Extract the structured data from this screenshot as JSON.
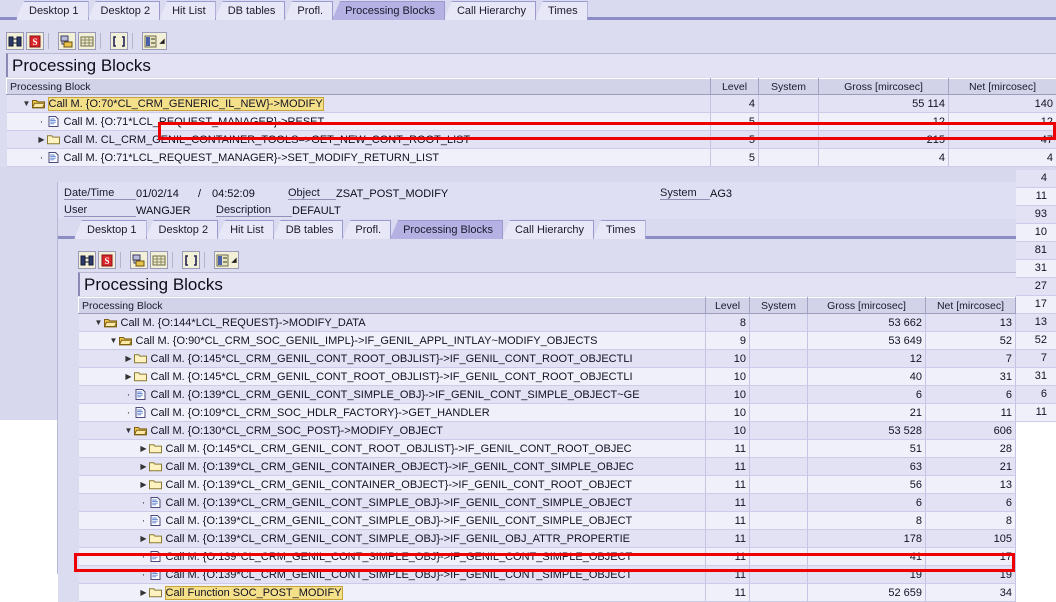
{
  "window1": {
    "tabs": [
      {
        "label": "Desktop 1",
        "active": false
      },
      {
        "label": "Desktop 2",
        "active": false
      },
      {
        "label": "Hit List",
        "active": false
      },
      {
        "label": "DB tables",
        "active": false
      },
      {
        "label": "Profl.",
        "active": false
      },
      {
        "label": "Processing Blocks",
        "active": true
      },
      {
        "label": "Call Hierarchy",
        "active": false
      },
      {
        "label": "Times",
        "active": false
      }
    ],
    "toolbar": [
      {
        "name": "find-icon",
        "glyph": "binoculars"
      },
      {
        "name": "find-next-icon",
        "glyph": "s-red"
      },
      {
        "name": "expand-tree-icon",
        "glyph": "tree"
      },
      {
        "name": "grid-icon",
        "glyph": "grid"
      },
      {
        "name": "brackets-icon",
        "glyph": "brackets"
      },
      {
        "name": "layout-menu-icon",
        "glyph": "layout-dd"
      }
    ],
    "title": "Processing Blocks",
    "columns": [
      "Processing Block",
      "Level",
      "System",
      "Gross [mircosec]",
      "Net [mircosec]"
    ],
    "rows": [
      {
        "indent": 4,
        "state": "open",
        "icon": "folder-open",
        "label": "Call M. {O:70*CL_CRM_GENERIC_IL_NEW}->MODIFY",
        "level": "4",
        "system": "",
        "gross": "55 114",
        "net": "140",
        "highlight": true
      },
      {
        "indent": 5,
        "state": "leaf",
        "icon": "page",
        "label": "Call M. {O:71*LCL_REQUEST_MANAGER}->RESET",
        "level": "5",
        "system": "",
        "gross": "12",
        "net": "12",
        "highlight": false
      },
      {
        "indent": 5,
        "state": "closed",
        "icon": "folder",
        "label": "Call M. CL_CRM_GENIL_CONTAINER_TOOLS=>GET_NEW_CONT_ROOT_LIST",
        "level": "5",
        "system": "",
        "gross": "215",
        "net": "47",
        "highlight": false
      },
      {
        "indent": 5,
        "state": "leaf",
        "icon": "page",
        "label": "Call M. {O:71*LCL_REQUEST_MANAGER}->SET_MODIFY_RETURN_LIST",
        "level": "5",
        "system": "",
        "gross": "4",
        "net": "4",
        "highlight": false
      }
    ],
    "tail_net_values": [
      "4",
      "11",
      "93",
      "10",
      "81",
      "31",
      "27",
      "17",
      "13",
      "52",
      "7",
      "31",
      "6",
      "11"
    ]
  },
  "window2": {
    "info": {
      "datetime_label": "Date/Time",
      "date_value": "01/02/14",
      "date_sep": "/",
      "time_value": "04:52:09",
      "object_label": "Object",
      "object_value": "ZSAT_POST_MODIFY",
      "system_label": "System",
      "system_value": "AG3",
      "user_label": "User",
      "user_value": "WANGJER",
      "description_label": "Description",
      "description_value": "DEFAULT"
    },
    "tabs": [
      {
        "label": "Desktop 1",
        "active": false
      },
      {
        "label": "Desktop 2",
        "active": false
      },
      {
        "label": "Hit List",
        "active": false
      },
      {
        "label": "DB tables",
        "active": false
      },
      {
        "label": "Profl.",
        "active": false
      },
      {
        "label": "Processing Blocks",
        "active": true
      },
      {
        "label": "Call Hierarchy",
        "active": false
      },
      {
        "label": "Times",
        "active": false
      }
    ],
    "toolbar": [
      {
        "name": "find-icon",
        "glyph": "binoculars"
      },
      {
        "name": "find-next-icon",
        "glyph": "s-red"
      },
      {
        "name": "expand-tree-icon",
        "glyph": "tree"
      },
      {
        "name": "grid-icon",
        "glyph": "grid"
      },
      {
        "name": "brackets-icon",
        "glyph": "brackets"
      },
      {
        "name": "layout-menu-icon",
        "glyph": "layout-dd"
      }
    ],
    "title": "Processing Blocks",
    "columns": [
      "Processing Block",
      "Level",
      "System",
      "Gross [mircosec]",
      "Net [mircosec]"
    ],
    "rows": [
      {
        "indent": 8,
        "state": "open",
        "icon": "folder-open",
        "label": "Call M. {O:144*LCL_REQUEST}->MODIFY_DATA",
        "level": "8",
        "system": "",
        "gross": "53 662",
        "net": "13",
        "highlight": false
      },
      {
        "indent": 9,
        "state": "open",
        "icon": "folder-open",
        "label": "Call M. {O:90*CL_CRM_SOC_GENIL_IMPL}->IF_GENIL_APPL_INTLAY~MODIFY_OBJECTS",
        "level": "9",
        "system": "",
        "gross": "53 649",
        "net": "52",
        "highlight": false
      },
      {
        "indent": 10,
        "state": "closed",
        "icon": "folder",
        "label": "Call M. {O:145*CL_CRM_GENIL_CONT_ROOT_OBJLIST}->IF_GENIL_CONT_ROOT_OBJECTLI",
        "level": "10",
        "system": "",
        "gross": "12",
        "net": "7",
        "highlight": false
      },
      {
        "indent": 10,
        "state": "closed",
        "icon": "folder",
        "label": "Call M. {O:145*CL_CRM_GENIL_CONT_ROOT_OBJLIST}->IF_GENIL_CONT_ROOT_OBJECTLI",
        "level": "10",
        "system": "",
        "gross": "40",
        "net": "31",
        "highlight": false
      },
      {
        "indent": 10,
        "state": "leaf",
        "icon": "page",
        "label": "Call M. {O:139*CL_CRM_GENIL_CONT_SIMPLE_OBJ}->IF_GENIL_CONT_SIMPLE_OBJECT~GE",
        "level": "10",
        "system": "",
        "gross": "6",
        "net": "6",
        "highlight": false
      },
      {
        "indent": 10,
        "state": "leaf",
        "icon": "page",
        "label": "Call M. {O:109*CL_CRM_SOC_HDLR_FACTORY}->GET_HANDLER",
        "level": "10",
        "system": "",
        "gross": "21",
        "net": "11",
        "highlight": false
      },
      {
        "indent": 10,
        "state": "open",
        "icon": "folder-open",
        "label": "Call M. {O:130*CL_CRM_SOC_POST}->MODIFY_OBJECT",
        "level": "10",
        "system": "",
        "gross": "53 528",
        "net": "606",
        "highlight": false
      },
      {
        "indent": 11,
        "state": "closed",
        "icon": "folder",
        "label": "Call M. {O:145*CL_CRM_GENIL_CONT_ROOT_OBJLIST}->IF_GENIL_CONT_ROOT_OBJEC",
        "level": "11",
        "system": "",
        "gross": "51",
        "net": "28",
        "highlight": false
      },
      {
        "indent": 11,
        "state": "closed",
        "icon": "folder",
        "label": "Call M. {O:139*CL_CRM_GENIL_CONTAINER_OBJECT}->IF_GENIL_CONT_SIMPLE_OBJEC",
        "level": "11",
        "system": "",
        "gross": "63",
        "net": "21",
        "highlight": false
      },
      {
        "indent": 11,
        "state": "closed",
        "icon": "folder",
        "label": "Call M. {O:139*CL_CRM_GENIL_CONTAINER_OBJECT}->IF_GENIL_CONT_ROOT_OBJECT",
        "level": "11",
        "system": "",
        "gross": "56",
        "net": "13",
        "highlight": false
      },
      {
        "indent": 11,
        "state": "leaf",
        "icon": "page",
        "label": "Call M. {O:139*CL_CRM_GENIL_CONT_SIMPLE_OBJ}->IF_GENIL_CONT_SIMPLE_OBJECT",
        "level": "11",
        "system": "",
        "gross": "6",
        "net": "6",
        "highlight": false
      },
      {
        "indent": 11,
        "state": "leaf",
        "icon": "page",
        "label": "Call M. {O:139*CL_CRM_GENIL_CONT_SIMPLE_OBJ}->IF_GENIL_CONT_SIMPLE_OBJECT",
        "level": "11",
        "system": "",
        "gross": "8",
        "net": "8",
        "highlight": false
      },
      {
        "indent": 11,
        "state": "closed",
        "icon": "folder",
        "label": "Call M. {O:139*CL_CRM_GENIL_CONT_SIMPLE_OBJ}->IF_GENIL_OBJ_ATTR_PROPERTIE",
        "level": "11",
        "system": "",
        "gross": "178",
        "net": "105",
        "highlight": false
      },
      {
        "indent": 11,
        "state": "leaf",
        "icon": "page",
        "label": "Call M. {O:139*CL_CRM_GENIL_CONT_SIMPLE_OBJ}->IF_GENIL_CONT_SIMPLE_OBJECT",
        "level": "11",
        "system": "",
        "gross": "41",
        "net": "17",
        "highlight": false
      },
      {
        "indent": 11,
        "state": "leaf",
        "icon": "page",
        "label": "Call M. {O:139*CL_CRM_GENIL_CONT_SIMPLE_OBJ}->IF_GENIL_CONT_SIMPLE_OBJECT",
        "level": "11",
        "system": "",
        "gross": "19",
        "net": "19",
        "highlight": false
      },
      {
        "indent": 11,
        "state": "closed",
        "icon": "folder",
        "label": "Call Function SOC_POST_MODIFY",
        "level": "11",
        "system": "",
        "gross": "52 659",
        "net": "34",
        "highlight": true
      }
    ]
  },
  "colors": {
    "accent": "#b5b1e3",
    "window_bg": "#dcdcf0",
    "row_odd": "#e2e2f4",
    "row_even": "#f0f0fb",
    "highlight": "#f5e08a",
    "emphasis": "#ee0000"
  }
}
